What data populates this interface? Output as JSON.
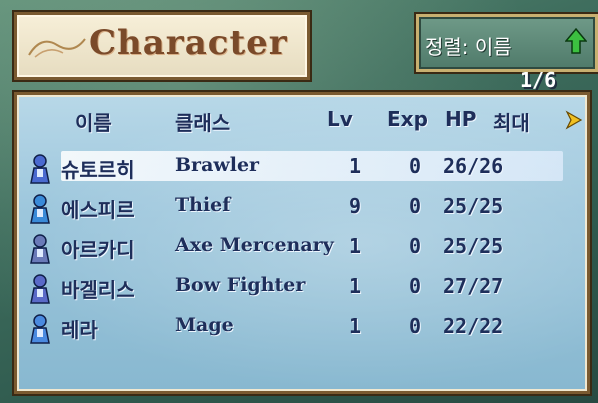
{
  "title": "Character",
  "sort": {
    "label": "정렬: 이름",
    "icon": "up-arrow-icon"
  },
  "page": "1/6",
  "headers": {
    "name": "이름",
    "class": "클래스",
    "lv": "Lv",
    "exp": "Exp",
    "hp": "HP",
    "max": "최대"
  },
  "units": [
    {
      "name": "슈토르히",
      "class": "Brawler",
      "lv": "1",
      "exp": "0",
      "hp": "26/26",
      "selected": true
    },
    {
      "name": "에스피르",
      "class": "Thief",
      "lv": "9",
      "exp": "0",
      "hp": "25/25"
    },
    {
      "name": "아르카디",
      "class": "Axe Mercenary",
      "lv": "1",
      "exp": "0",
      "hp": "25/25"
    },
    {
      "name": "바겔리스",
      "class": "Bow Fighter",
      "lv": "1",
      "exp": "0",
      "hp": "27/27"
    },
    {
      "name": "레라",
      "class": "Mage",
      "lv": "1",
      "exp": "0",
      "hp": "22/22"
    }
  ],
  "colors": {
    "text": "#1e2e5a",
    "highlight": "#ffffff",
    "title": "#7a4a2a",
    "accent_green": "#3cc040",
    "accent_yellow": "#f0c020"
  }
}
